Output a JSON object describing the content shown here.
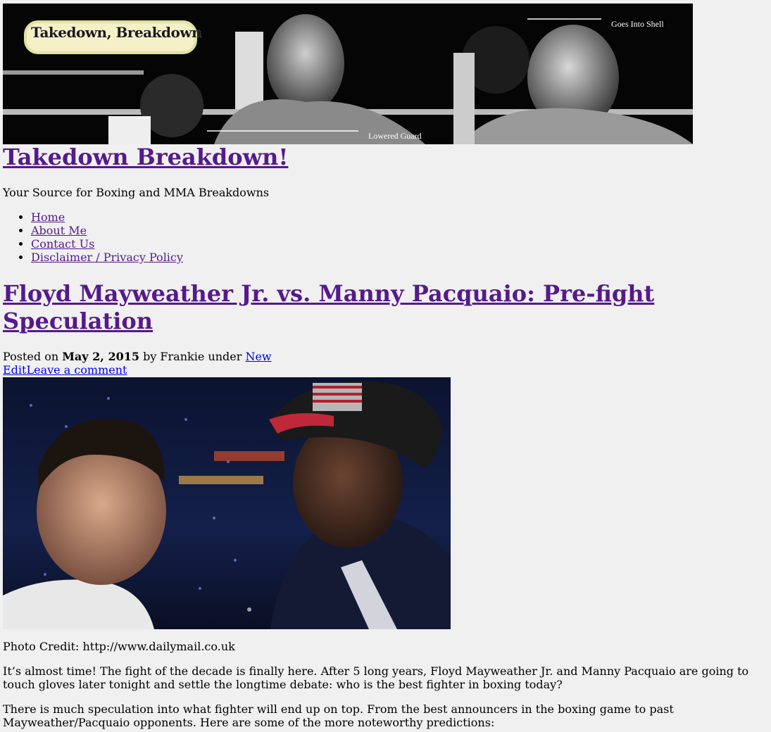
{
  "banner": {
    "logo": "Takedown, Breakdown",
    "caption_top": "Goes Into Shell",
    "caption_bottom": "Lowered Guard"
  },
  "site": {
    "title": "Takedown Breakdown!",
    "tagline": "Your Source for Boxing and MMA Breakdowns"
  },
  "nav": {
    "items": [
      {
        "label": "Home"
      },
      {
        "label": "About Me"
      },
      {
        "label": "Contact Us"
      },
      {
        "label": "Disclaimer / Privacy Policy"
      }
    ]
  },
  "post": {
    "title": "Floyd Mayweather Jr. vs. Manny Pacquaio: Pre-fight Speculation",
    "meta": {
      "posted_on": "Posted on",
      "date": "May 2, 2015",
      "by": "by Frankie under",
      "category": "New",
      "edit": "Edit",
      "comment": "Leave a comment"
    },
    "photo_credit": "Photo Credit: http://www.dailymail.co.uk",
    "paragraphs": [
      "It’s almost time! The fight of the decade is finally here. After 5 long years, Floyd Mayweather Jr. and Manny Pacquaio are going to touch gloves later tonight and settle the longtime debate: who is the best fighter in boxing today?",
      "There is much speculation into what fighter will end up on top.  From the best announcers in the boxing game to past Mayweather/Pacquaio opponents.  Here are some of the more noteworthy predictions:"
    ]
  }
}
